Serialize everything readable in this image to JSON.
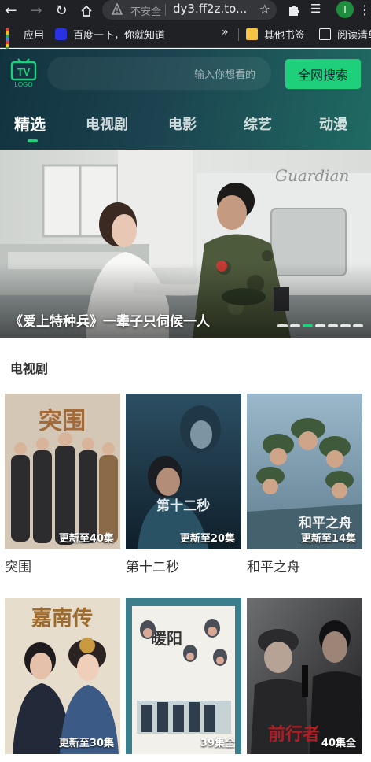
{
  "browser": {
    "address_insecure_label": "不安全",
    "address_url": "dy3.ff2z.to...",
    "profile_initial": "I",
    "bookmarks": [
      "应用",
      "百度一下，你就知道",
      "其他书签",
      "阅读清单"
    ]
  },
  "site": {
    "logo_text": "TV",
    "logo_sub": "LOGO",
    "search_placeholder": "输入你想看的",
    "search_button": "全网搜索",
    "tabs": [
      "精选",
      "电视剧",
      "电影",
      "综艺",
      "动漫"
    ],
    "active_tab": "精选",
    "accent_color": "#1ed07a"
  },
  "banner": {
    "caption": "《爱上特种兵》一辈子只伺候一人",
    "slide_count": 7,
    "active_slide": 3
  },
  "section": {
    "title": "电视剧",
    "items": [
      {
        "title": "突围",
        "badge": "更新至40集",
        "poster_text": "突围"
      },
      {
        "title": "第十二秒",
        "badge": "更新至20集",
        "poster_text": "第十二秒"
      },
      {
        "title": "和平之舟",
        "badge": "更新至14集",
        "poster_text": "和平之舟"
      },
      {
        "title": "",
        "badge": "更新至30集",
        "poster_text": "嘉南传"
      },
      {
        "title": "",
        "badge": "39集全",
        "poster_text": "暖阳"
      },
      {
        "title": "",
        "badge": "40集全",
        "poster_text": "前行者"
      }
    ]
  }
}
